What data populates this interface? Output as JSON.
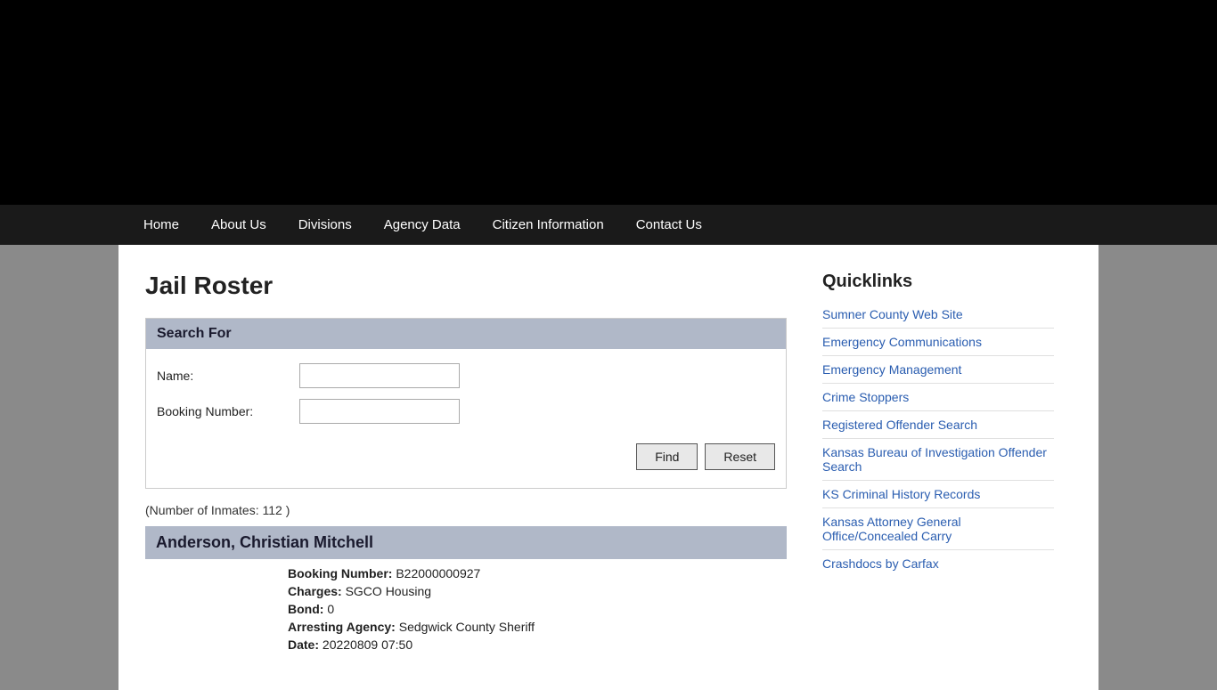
{
  "header": {
    "background": "#000"
  },
  "nav": {
    "items": [
      {
        "label": "Home",
        "id": "home"
      },
      {
        "label": "About Us",
        "id": "about-us"
      },
      {
        "label": "Divisions",
        "id": "divisions"
      },
      {
        "label": "Agency Data",
        "id": "agency-data"
      },
      {
        "label": "Citizen Information",
        "id": "citizen-information"
      },
      {
        "label": "Contact Us",
        "id": "contact-us"
      }
    ]
  },
  "main": {
    "page_title": "Jail Roster",
    "search": {
      "section_title": "Search For",
      "name_label": "Name:",
      "name_placeholder": "",
      "booking_label": "Booking Number:",
      "booking_placeholder": "",
      "find_button": "Find",
      "reset_button": "Reset"
    },
    "inmate_count": "(Number of Inmates: 112 )",
    "inmate": {
      "name": "Anderson, Christian Mitchell",
      "booking_number_label": "Booking Number:",
      "booking_number": "B22000000927",
      "charges_label": "Charges:",
      "charges": "SGCO Housing",
      "bond_label": "Bond:",
      "bond": "0",
      "arresting_agency_label": "Arresting Agency:",
      "arresting_agency": "Sedgwick County Sheriff",
      "date_label": "Date:",
      "date": "20220809 07:50"
    }
  },
  "sidebar": {
    "title": "Quicklinks",
    "links": [
      {
        "label": "Sumner County Web Site",
        "id": "sumner-county"
      },
      {
        "label": "Emergency Communications",
        "id": "emergency-communications"
      },
      {
        "label": "Emergency Management",
        "id": "emergency-management"
      },
      {
        "label": "Crime Stoppers",
        "id": "crime-stoppers"
      },
      {
        "label": "Registered Offender Search",
        "id": "registered-offender-search"
      },
      {
        "label": "Kansas Bureau of Investigation Offender Search",
        "id": "kbi-offender-search"
      },
      {
        "label": "KS Criminal History Records",
        "id": "ks-criminal-history"
      },
      {
        "label": "Kansas Attorney General Office/Concealed Carry",
        "id": "concealed-carry"
      },
      {
        "label": "Crashdocs by Carfax",
        "id": "crashdocs"
      }
    ]
  }
}
